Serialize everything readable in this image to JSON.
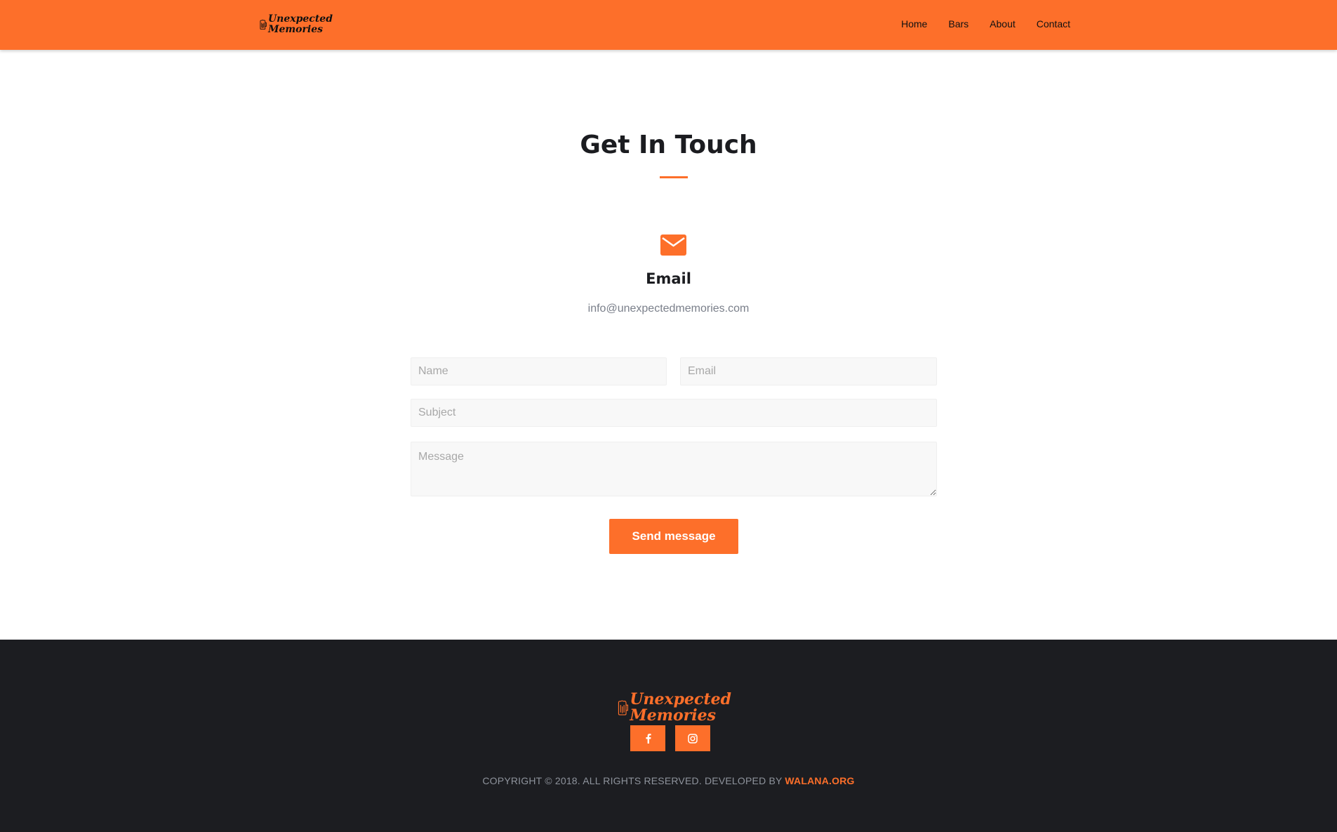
{
  "header": {
    "logo_line1": "Unexpected",
    "logo_line2": "Memories",
    "nav": [
      {
        "label": "Home"
      },
      {
        "label": "Bars"
      },
      {
        "label": "About"
      },
      {
        "label": "Contact"
      }
    ]
  },
  "main": {
    "title": "Get In Touch",
    "contact_icon": "envelope-icon",
    "email_heading": "Email",
    "email_address": "info@unexpectedmemories.com"
  },
  "form": {
    "name_placeholder": "Name",
    "email_placeholder": "Email",
    "subject_placeholder": "Subject",
    "message_placeholder": "Message",
    "submit_label": "Send message"
  },
  "footer": {
    "logo_line1": "Unexpected",
    "logo_line2": "Memories",
    "social": [
      {
        "icon": "facebook-icon"
      },
      {
        "icon": "instagram-icon"
      }
    ],
    "copyright_text": "COPYRIGHT © 2018. ALL RIGHTS RESERVED. DEVELOPED BY",
    "developer_link": "WALANA.ORG"
  },
  "colors": {
    "accent": "#fd6f2a",
    "footer_bg": "#1c1d21",
    "heading": "#1b1c20",
    "muted_text": "#7a7f8a"
  }
}
